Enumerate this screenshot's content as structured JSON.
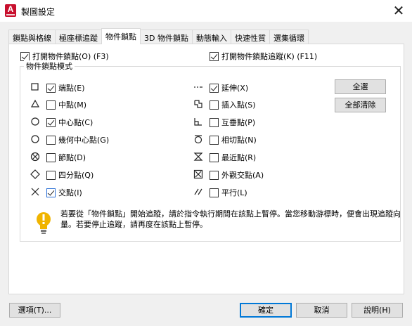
{
  "window": {
    "app_icon_letter": "A",
    "title": "製圖設定",
    "close_glyph": "✕"
  },
  "tabs": [
    {
      "label": "鎖點與格線",
      "active": false
    },
    {
      "label": "極座標追蹤",
      "active": false
    },
    {
      "label": "物件鎖點",
      "active": true
    },
    {
      "label": "3D 物件鎖點",
      "active": false
    },
    {
      "label": "動態輸入",
      "active": false
    },
    {
      "label": "快速性質",
      "active": false
    },
    {
      "label": "選集循環",
      "active": false
    }
  ],
  "osnap_on": {
    "label": "打開物件鎖點(O) (F3)",
    "checked": true
  },
  "osnap_tracking": {
    "label": "打開物件鎖點追蹤(K) (F11)",
    "checked": true
  },
  "group_title": "物件鎖點模式",
  "left_modes": [
    {
      "label": "端點(E)",
      "checked": true,
      "icon": "square-icon"
    },
    {
      "label": "中點(M)",
      "checked": false,
      "icon": "triangle-icon"
    },
    {
      "label": "中心點(C)",
      "checked": true,
      "icon": "circle-icon"
    },
    {
      "label": "幾何中心點(G)",
      "checked": false,
      "icon": "circle-icon"
    },
    {
      "label": "節點(D)",
      "checked": false,
      "icon": "node-icon"
    },
    {
      "label": "四分點(Q)",
      "checked": false,
      "icon": "diamond-icon"
    },
    {
      "label": "交點(I)",
      "checked": true,
      "icon": "cross-icon"
    }
  ],
  "right_modes": [
    {
      "label": "延伸(X)",
      "checked": true,
      "icon": "extension-icon"
    },
    {
      "label": "插入點(S)",
      "checked": false,
      "icon": "insertion-icon"
    },
    {
      "label": "互垂點(P)",
      "checked": false,
      "icon": "perpendicular-icon"
    },
    {
      "label": "相切點(N)",
      "checked": false,
      "icon": "tangent-icon"
    },
    {
      "label": "最近點(R)",
      "checked": false,
      "icon": "nearest-icon"
    },
    {
      "label": "外觀交點(A)",
      "checked": false,
      "icon": "apparent-intersection-icon"
    },
    {
      "label": "平行(L)",
      "checked": false,
      "icon": "parallel-icon"
    }
  ],
  "buttons": {
    "select_all": "全選",
    "clear_all": "全部清除",
    "options": "選項(T)...",
    "ok": "確定",
    "cancel": "取消",
    "help": "說明(H)"
  },
  "hint": {
    "icon": "lightbulb-icon",
    "text": "若要從「物件鎖點」開始追蹤，請於指令執行期間在該點上暫停。當您移動游標時，便會出現追蹤向量。若要停止追蹤，請再度在該點上暫停。"
  },
  "colors": {
    "accent": "#0078d7",
    "app_icon": "#c8102e",
    "hint_bulb": "#f0b400"
  }
}
